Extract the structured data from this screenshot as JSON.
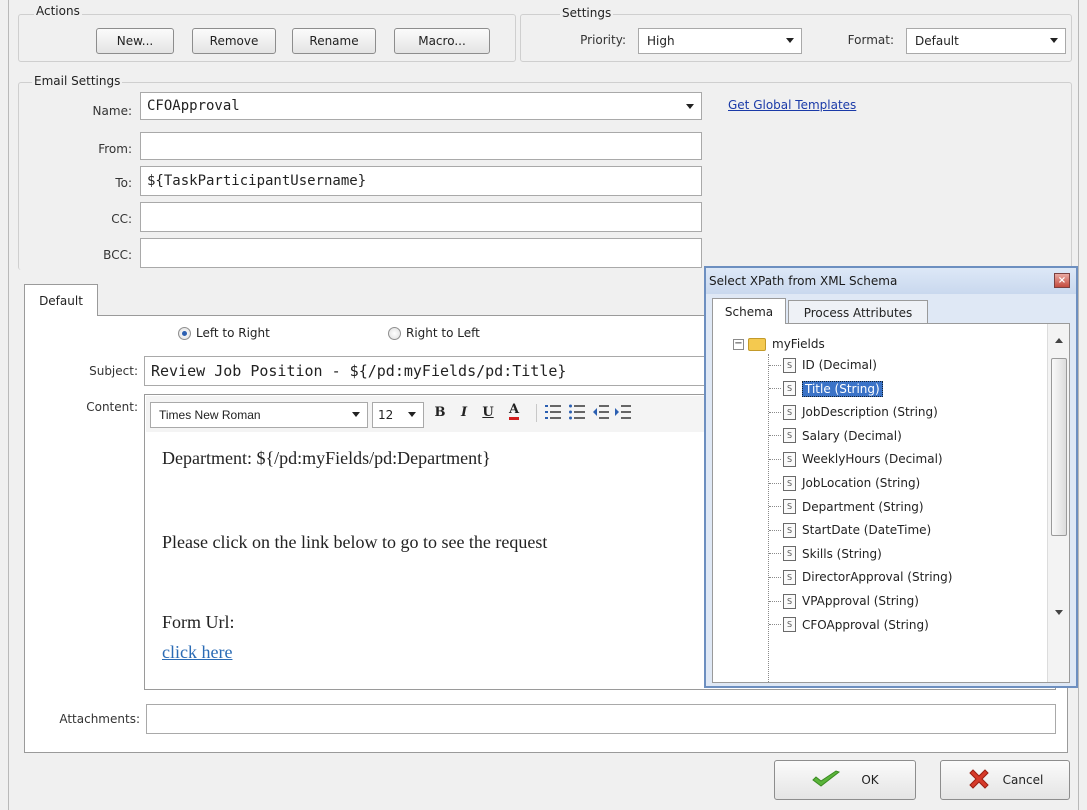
{
  "actions": {
    "group_label": "Actions",
    "new_label": "New...",
    "remove_label": "Remove",
    "rename_label": "Rename",
    "macro_label": "Macro..."
  },
  "settings": {
    "group_label": "Settings",
    "priority_label": "Priority:",
    "priority_value": "High",
    "format_label": "Format:",
    "format_value": "Default"
  },
  "email": {
    "group_label": "Email Settings",
    "name_label": "Name:",
    "name_value": "CFOApproval",
    "global_templates_link": "Get Global Templates",
    "from_label": "From:",
    "from_value": "",
    "to_label": "To:",
    "to_value": "${TaskParticipantUsername}",
    "cc_label": "CC:",
    "cc_value": "",
    "bcc_label": "BCC:",
    "bcc_value": ""
  },
  "tab": {
    "label": "Default",
    "ltr_label": "Left to Right",
    "rtl_label": "Right to Left",
    "subject_label": "Subject:",
    "subject_value": "Review Job Position - ${/pd:myFields/pd:Title}",
    "content_label": "Content:",
    "font_name": "Times New Roman",
    "font_size": "12",
    "bold": "B",
    "italic": "I",
    "underline": "U",
    "color": "A",
    "body_line1": "Department: ${/pd:myFields/pd:Department}",
    "body_line2": "Please click on the link below to go to see the request",
    "body_line3": "Form Url:",
    "body_link": "click here",
    "attachments_label": "Attachments:",
    "attachments_value": ""
  },
  "xpath_dialog": {
    "title": "Select XPath from XML Schema",
    "tabs": [
      "Schema",
      "Process Attributes"
    ],
    "root": "myFields",
    "nodes": [
      "ID (Decimal)",
      "Title (String)",
      "JobDescription (String)",
      "Salary (Decimal)",
      "WeeklyHours (Decimal)",
      "JobLocation (String)",
      "Department (String)",
      "StartDate (DateTime)",
      "Skills (String)",
      "DirectorApproval (String)",
      "VPApproval (String)",
      "CFOApproval (String)"
    ],
    "selected_index": 1
  },
  "footer": {
    "ok_label": "OK",
    "cancel_label": "Cancel"
  },
  "colors": {
    "accent": "#3b73c7",
    "link": "#1a3aa8",
    "dialog_border": "#6d8fc0"
  }
}
